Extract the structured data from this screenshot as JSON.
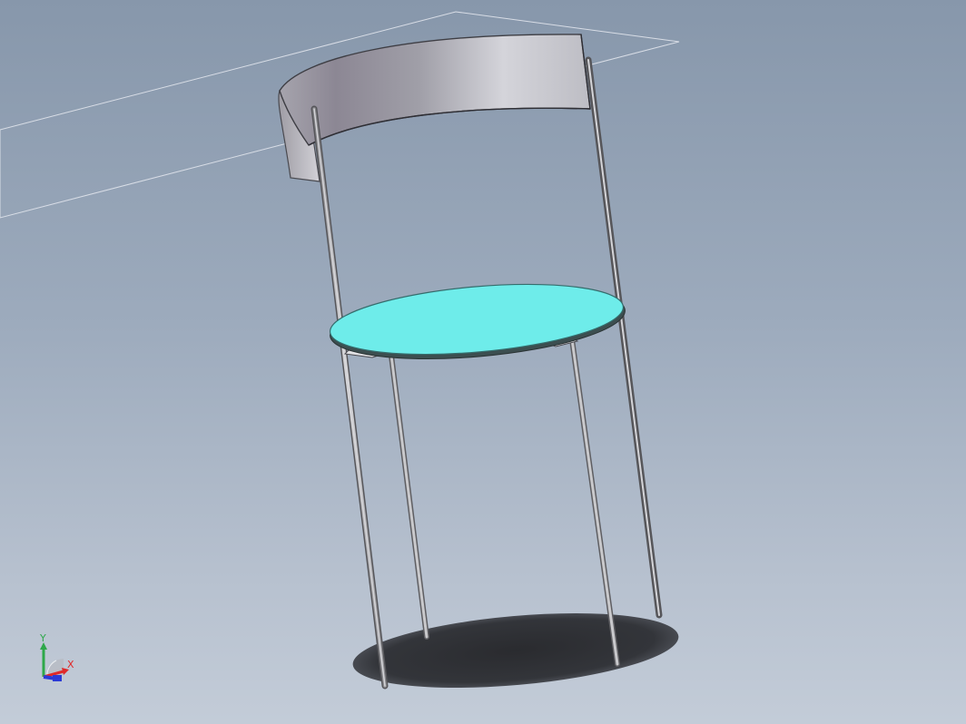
{
  "viewport": {
    "title": "",
    "background_top": "#8797ab",
    "background_bottom": "#c3ccd8"
  },
  "model": {
    "seat_color": "#6eecea",
    "backrest_color": "#b9b7c0",
    "leg_color": "#a9a9ab",
    "shadow_color": "#2f3034",
    "plane_outline_color": "#d8dde6"
  },
  "triad": {
    "x_label": "X",
    "y_label": "Y",
    "x_color": "#e02a2a",
    "y_color": "#2ea84a",
    "z_color": "#2b3ad6"
  }
}
